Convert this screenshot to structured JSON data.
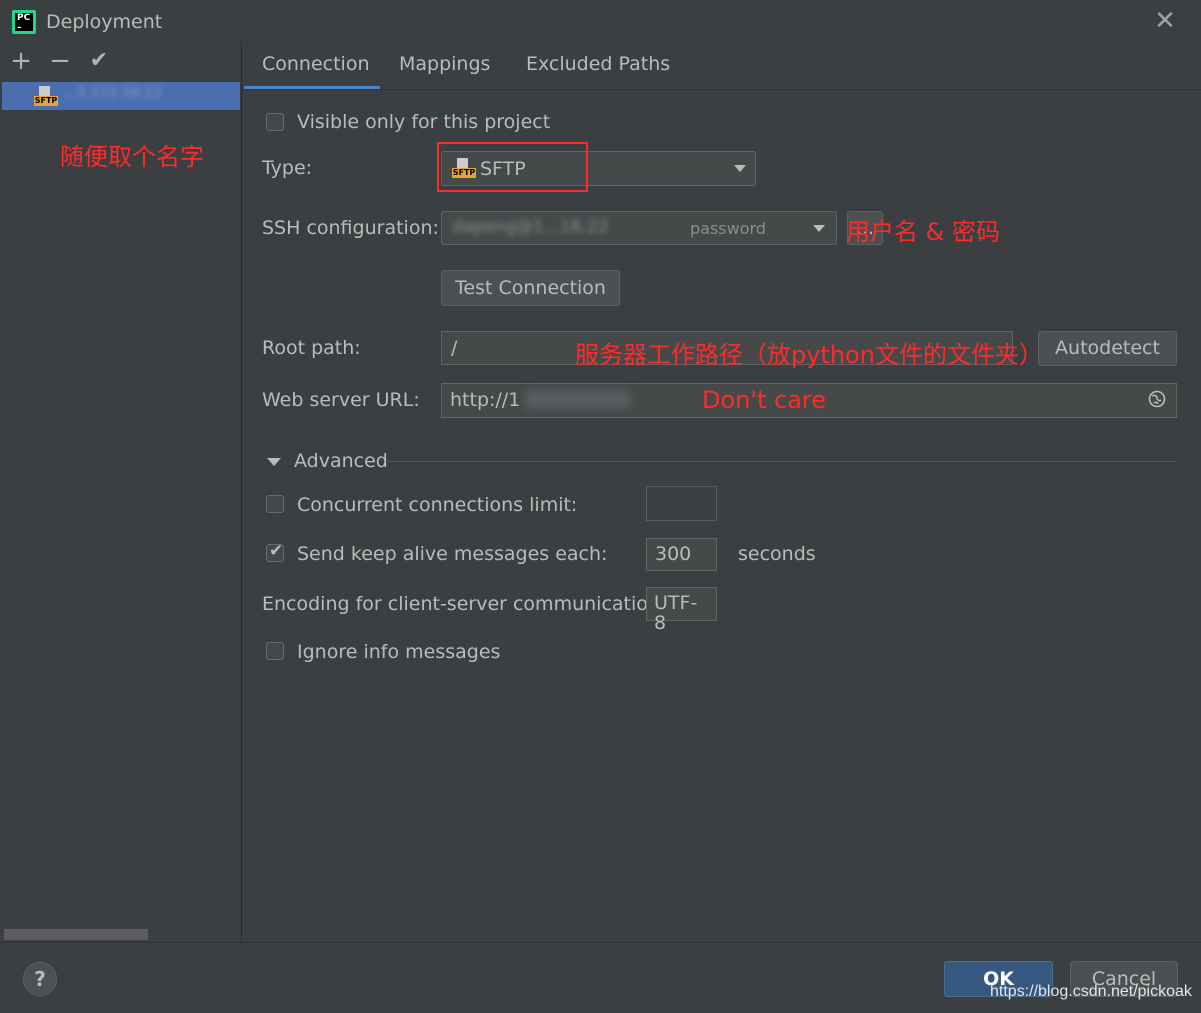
{
  "window": {
    "title": "Deployment"
  },
  "toolbar": {
    "add": "+",
    "remove": "−",
    "apply": "✔"
  },
  "server_list": {
    "items": [
      {
        "type_badge": "SFTP",
        "name": "...5.172.16.12"
      }
    ]
  },
  "annotations": {
    "name_hint": "随便取个名字",
    "credentials_hint": "用户名 & 密码",
    "root_path_hint": "服务器工作路径（放python文件的文件夹）",
    "web_url_hint": "Don't care"
  },
  "tabs": [
    {
      "label": "Connection",
      "active": true
    },
    {
      "label": "Mappings"
    },
    {
      "label": "Excluded Paths"
    }
  ],
  "form": {
    "visible_only_label": "Visible only for this project",
    "visible_only_checked": false,
    "type_label": "Type:",
    "type_value": "SFTP",
    "type_badge": "SFTP",
    "ssh_label": "SSH configuration:",
    "ssh_value": "dapeng@1...16.22",
    "ssh_auth": "password",
    "ssh_more": "...",
    "test_button": "Test Connection",
    "root_label": "Root path:",
    "root_value": "/",
    "autodetect_button": "Autodetect",
    "web_label": "Web server URL:",
    "web_value": "http://1",
    "advanced_label": "Advanced",
    "concurrent_label": "Concurrent connections limit:",
    "concurrent_checked": false,
    "concurrent_value": "",
    "keepalive_label": "Send keep alive messages each:",
    "keepalive_checked": true,
    "keepalive_value": "300",
    "keepalive_unit": "seconds",
    "encoding_label": "Encoding for client-server communication:",
    "encoding_value": "UTF-8",
    "ignore_label": "Ignore info messages",
    "ignore_checked": false
  },
  "footer": {
    "help": "?",
    "ok": "OK",
    "cancel": "Cancel",
    "watermark": "https://blog.csdn.net/pickoak"
  },
  "colors": {
    "background": "#3c3f41",
    "accent": "#4a88c7",
    "selection": "#4b6eaf",
    "annotation": "#ff2a2a",
    "ok_button": "#365880"
  }
}
